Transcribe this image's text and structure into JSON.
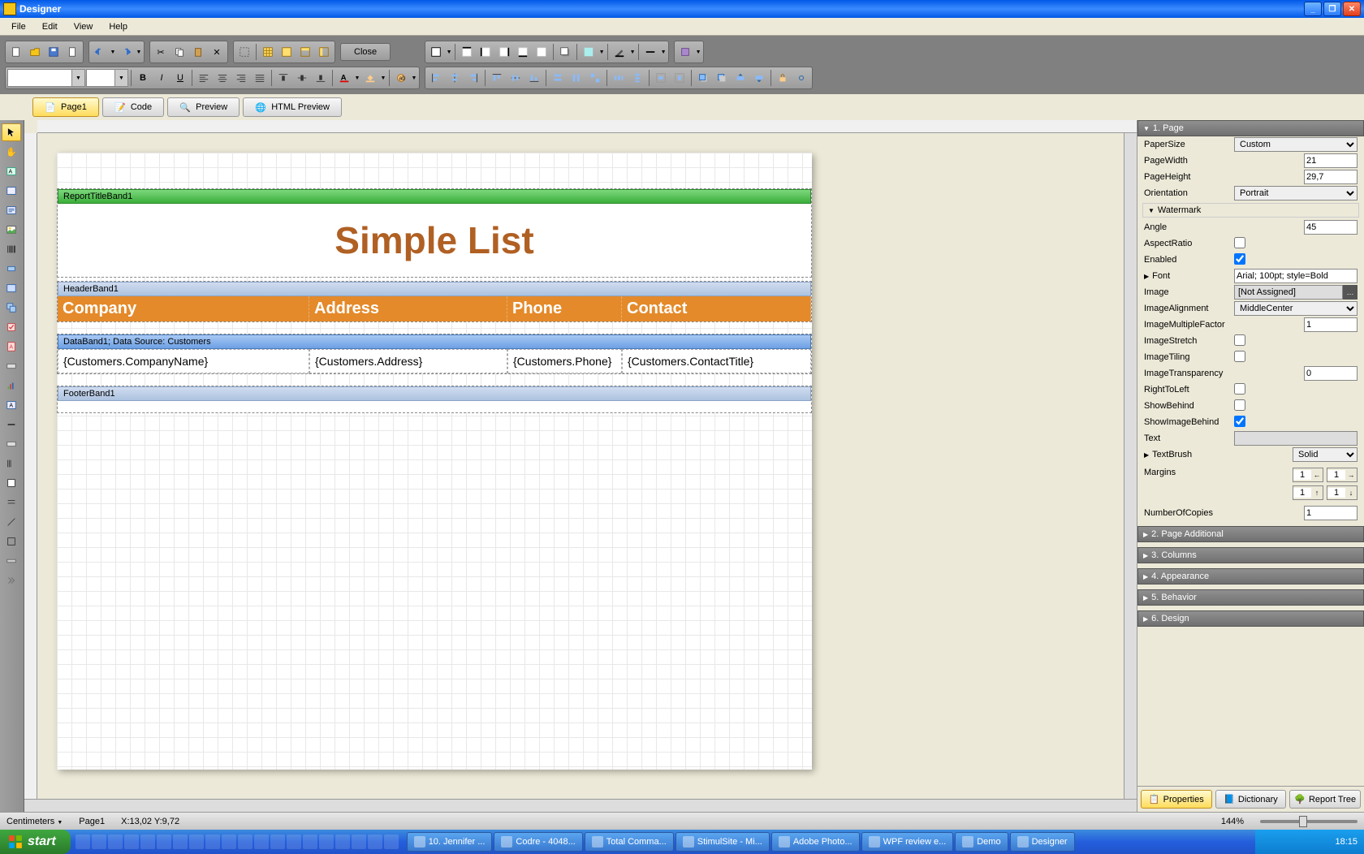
{
  "window": {
    "title": "Designer"
  },
  "menu": {
    "items": [
      "File",
      "Edit",
      "View",
      "Help"
    ]
  },
  "toolbar": {
    "close": "Close"
  },
  "tabs": {
    "page": "Page1",
    "code": "Code",
    "preview": "Preview",
    "html_preview": "HTML Preview"
  },
  "design": {
    "report_title_band": "ReportTitleBand1",
    "report_title_text": "Simple List",
    "header_band": "HeaderBand1",
    "columns": {
      "company": "Company",
      "address": "Address",
      "phone": "Phone",
      "contact": "Contact"
    },
    "data_band": "DataBand1; Data Source: Customers",
    "data_fields": {
      "company": "{Customers.CompanyName}",
      "address": "{Customers.Address}",
      "phone": "{Customers.Phone}",
      "contact": "{Customers.ContactTitle}"
    },
    "footer_band": "FooterBand1"
  },
  "props": {
    "section1": "1. Page",
    "paper_size": {
      "label": "PaperSize",
      "value": "Custom"
    },
    "page_width": {
      "label": "PageWidth",
      "value": "21"
    },
    "page_height": {
      "label": "PageHeight",
      "value": "29,7"
    },
    "orientation": {
      "label": "Orientation",
      "value": "Portrait"
    },
    "watermark": "Watermark",
    "angle": {
      "label": "Angle",
      "value": "45"
    },
    "aspect_ratio": {
      "label": "AspectRatio",
      "checked": false
    },
    "enabled": {
      "label": "Enabled",
      "checked": true
    },
    "font": {
      "label": "Font",
      "value": "Arial; 100pt; style=Bold"
    },
    "image": {
      "label": "Image",
      "value": "[Not Assigned]"
    },
    "image_alignment": {
      "label": "ImageAlignment",
      "value": "MiddleCenter"
    },
    "image_multiple_factor": {
      "label": "ImageMultipleFactor",
      "value": "1"
    },
    "image_stretch": {
      "label": "ImageStretch",
      "checked": false
    },
    "image_tiling": {
      "label": "ImageTiling",
      "checked": false
    },
    "image_transparency": {
      "label": "ImageTransparency",
      "value": "0"
    },
    "right_to_left": {
      "label": "RightToLeft",
      "checked": false
    },
    "show_behind": {
      "label": "ShowBehind",
      "checked": false
    },
    "show_image_behind": {
      "label": "ShowImageBehind",
      "checked": true
    },
    "text": {
      "label": "Text",
      "value": ""
    },
    "text_brush": {
      "label": "TextBrush",
      "value": "Solid"
    },
    "margins": {
      "label": "Margins",
      "left": "1",
      "right": "1",
      "top": "1",
      "bottom": "1"
    },
    "number_of_copies": {
      "label": "NumberOfCopies",
      "value": "1"
    },
    "section2": "2. Page Additional",
    "section3": "3. Columns",
    "section4": "4. Appearance",
    "section5": "5. Behavior",
    "section6": "6. Design"
  },
  "panel_tabs": {
    "properties": "Properties",
    "dictionary": "Dictionary",
    "report_tree": "Report Tree"
  },
  "status": {
    "units": "Centimeters",
    "page": "Page1",
    "coords": "X:13,02  Y:9,72",
    "zoom": "144%"
  },
  "taskbar": {
    "start": "start",
    "items": [
      "10. Jennifer ...",
      "Codre - 4048...",
      "Total Comma...",
      "StimulSite - Mi...",
      "Adobe Photo...",
      "WPF review e...",
      "Demo",
      "Designer"
    ],
    "time": "18:15"
  }
}
